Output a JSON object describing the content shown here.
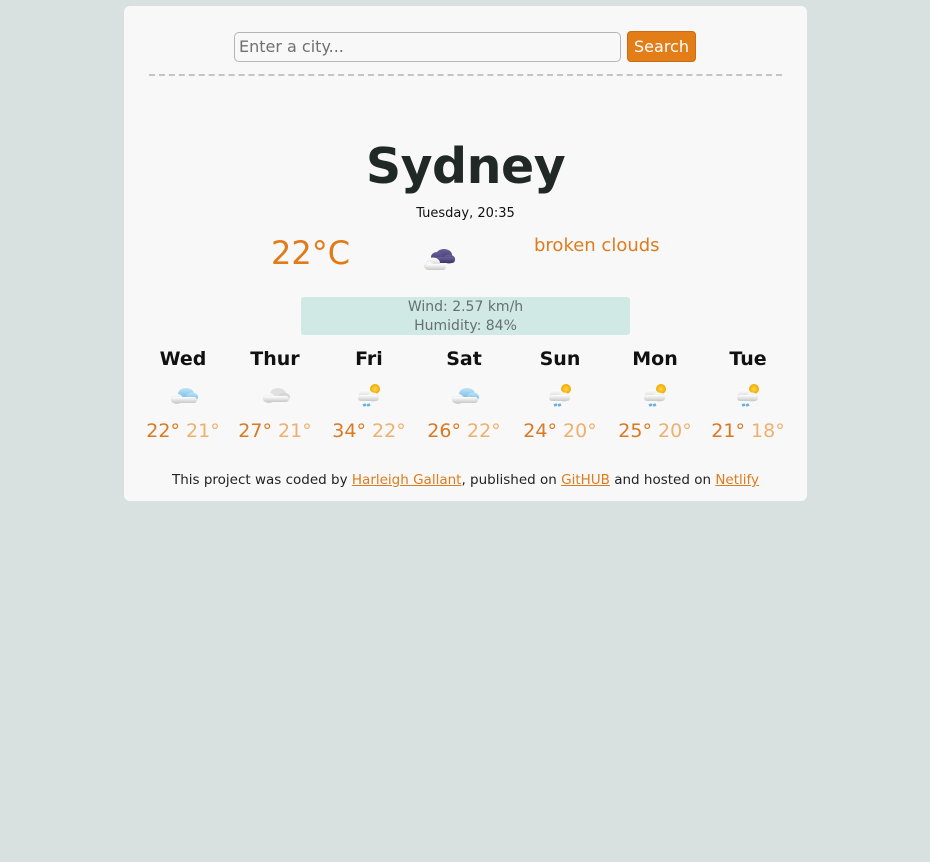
{
  "search": {
    "placeholder": "Enter a city...",
    "button_label": "Search"
  },
  "current": {
    "city": "Sydney",
    "datetime": "Tuesday, 20:35",
    "temperature": "22°C",
    "icon": "broken-clouds-icon",
    "description": "broken clouds",
    "wind": "Wind: 2.57 km/h",
    "humidity": "Humidity: 84%"
  },
  "forecast": [
    {
      "day": "Wed",
      "max": "22°",
      "min": "21°",
      "icon": "light-rain-clouds-icon"
    },
    {
      "day": "Thur",
      "max": "27°",
      "min": "21°",
      "icon": "overcast-clouds-icon"
    },
    {
      "day": "Fri",
      "max": "34°",
      "min": "22°",
      "icon": "sun-showers-icon"
    },
    {
      "day": "Sat",
      "max": "26°",
      "min": "22°",
      "icon": "light-rain-clouds-icon"
    },
    {
      "day": "Sun",
      "max": "24°",
      "min": "20°",
      "icon": "sun-showers-icon"
    },
    {
      "day": "Mon",
      "max": "25°",
      "min": "20°",
      "icon": "sun-showers-icon"
    },
    {
      "day": "Tue",
      "max": "21°",
      "min": "18°",
      "icon": "sun-showers-icon"
    }
  ],
  "footer": {
    "text_1": "This project was coded by ",
    "author_link": "Harleigh Gallant",
    "text_2": ", published on ",
    "github_link": "GitHUB",
    "text_3": " and hosted on ",
    "netlify_link": "Netlify"
  },
  "colors": {
    "background": "#d8e1df",
    "card": "#f8f8f8",
    "accent": "#e27d18",
    "details_bg": "#d0e9e5",
    "min_temp": "#efb06e"
  }
}
